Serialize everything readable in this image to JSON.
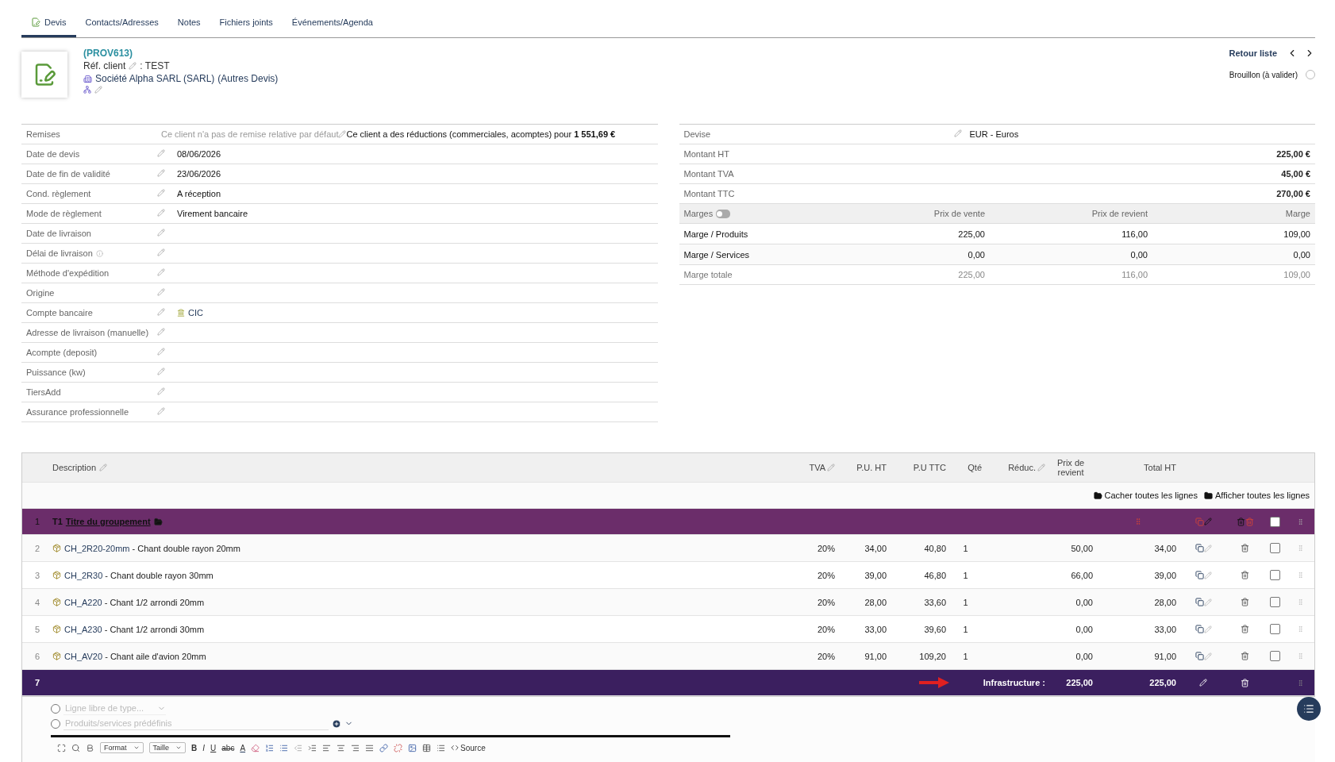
{
  "tabs": [
    {
      "label": "Devis",
      "selected": true
    },
    {
      "label": "Contacts/Adresses",
      "selected": false
    },
    {
      "label": "Notes",
      "selected": false
    },
    {
      "label": "Fichiers joints",
      "selected": false
    },
    {
      "label": "Événements/Agenda",
      "selected": false
    }
  ],
  "header": {
    "ref": "(PROV613)",
    "client_ref_label": "Réf. client",
    "client_ref_value": ": TEST",
    "company": "Société Alpha SARL (SARL)",
    "other_link": "(Autres Devis)",
    "back_link": "Retour liste",
    "status": "Brouillon (à valider)"
  },
  "info_fields": [
    {
      "label": "Remises",
      "note": "Ce client n'a pas de remise relative par défaut",
      "value": "Ce client a des réductions (commerciales, acomptes) pour **1 551,69 €**",
      "kind": "discount"
    },
    {
      "label": "Date de devis",
      "value": "08/06/2026",
      "kind": "plain"
    },
    {
      "label": "Date de fin de validité",
      "value": "23/06/2026",
      "kind": "plain"
    },
    {
      "label": "Cond. règlement",
      "value": "A réception",
      "kind": "plain"
    },
    {
      "label": "Mode de règlement",
      "value": "Virement bancaire",
      "kind": "plain"
    },
    {
      "label": "Date de livraison",
      "kind": "plain"
    },
    {
      "label": "Délai de livraison",
      "kind": "info"
    },
    {
      "label": "Méthode d'expédition",
      "kind": "plain"
    },
    {
      "label": "Origine",
      "kind": "plain"
    },
    {
      "label": "Compte bancaire",
      "value": "CIC",
      "kind": "bank"
    },
    {
      "label": "Adresse de livraison (manuelle)",
      "kind": "plain"
    },
    {
      "label": "Acompte (deposit)",
      "kind": "plain"
    },
    {
      "label": "Puissance (kw)",
      "kind": "plain"
    },
    {
      "label": "TiersAdd",
      "kind": "plain"
    },
    {
      "label": "Assurance professionnelle",
      "kind": "plain"
    }
  ],
  "totals": {
    "currency_label": "Devise",
    "currency": "EUR - Euros",
    "rows": [
      {
        "label": "Montant HT",
        "value": "225,00 €"
      },
      {
        "label": "Montant TVA",
        "value": "45,00 €"
      },
      {
        "label": "Montant TTC",
        "value": "270,00 €"
      }
    ]
  },
  "margins": {
    "label": "Marges",
    "on": false,
    "columns": [
      "Prix de vente",
      "Prix de revient",
      "Marge"
    ],
    "rows": [
      {
        "label": "Marge / Produits",
        "values": [
          "225,00",
          "116,00",
          "109,00"
        ],
        "kind": "line"
      },
      {
        "label": "Marge / Services",
        "values": [
          "0,00",
          "0,00",
          "0,00"
        ],
        "kind": "line"
      },
      {
        "label": "Marge totale",
        "values": [
          "225,00",
          "116,00",
          "109,00"
        ],
        "kind": "total"
      }
    ]
  },
  "lines": {
    "columns": [
      "Description",
      "TVA",
      "P.U. HT",
      "P.U TTC",
      "Qté",
      "Réduc.",
      "Prix de revient",
      "Total HT"
    ],
    "hide_all": "Cacher toutes les lignes",
    "show_all": "Afficher toutes les lignes",
    "rows": [
      {
        "kind": "group",
        "num": "1",
        "level": "T1",
        "title": "Titre du groupement",
        "checked": false
      },
      {
        "kind": "product",
        "num": "2",
        "ref": "CH_2R20-20mm",
        "label": " - Chant double rayon 20mm",
        "tva": "20%",
        "pu_ht": "34,00",
        "pu_ttc": "40,80",
        "qty": "1",
        "cost": "50,00",
        "total": "34,00",
        "checked": false
      },
      {
        "kind": "product",
        "num": "3",
        "ref": "CH_2R30",
        "label": " - Chant double rayon 30mm",
        "tva": "20%",
        "pu_ht": "39,00",
        "pu_ttc": "46,80",
        "qty": "1",
        "cost": "66,00",
        "total": "39,00",
        "checked": false
      },
      {
        "kind": "product",
        "num": "4",
        "ref": "CH_A220",
        "label": " - Chant 1/2 arrondi 20mm",
        "tva": "20%",
        "pu_ht": "28,00",
        "pu_ttc": "33,60",
        "qty": "1",
        "cost": "0,00",
        "total": "28,00",
        "checked": false
      },
      {
        "kind": "product",
        "num": "5",
        "ref": "CH_A230",
        "label": " - Chant 1/2 arrondi 30mm",
        "tva": "20%",
        "pu_ht": "33,00",
        "pu_ttc": "39,60",
        "qty": "1",
        "cost": "0,00",
        "total": "33,00",
        "checked": false
      },
      {
        "kind": "product",
        "num": "6",
        "ref": "CH_AV20",
        "label": " - Chant aile d'avion 20mm",
        "tva": "20%",
        "pu_ht": "91,00",
        "pu_ttc": "109,20",
        "qty": "1",
        "cost": "0,00",
        "total": "91,00",
        "checked": false
      },
      {
        "kind": "subtotal",
        "num": "7",
        "label": "Infrastructure :",
        "cost": "225,00",
        "total": "225,00"
      }
    ]
  },
  "add_line": {
    "options": [
      {
        "placeholder": "Ligne libre de type...",
        "selected": false,
        "kind": "select"
      },
      {
        "placeholder": "Produits/services prédéfinis",
        "selected": false,
        "kind": "search"
      }
    ],
    "toolbar": {
      "format": "Format",
      "size": "Taille",
      "bold": "B",
      "italic": "I",
      "underline": "U",
      "strike": "abc",
      "font_color": "A",
      "source": "Source"
    }
  }
}
